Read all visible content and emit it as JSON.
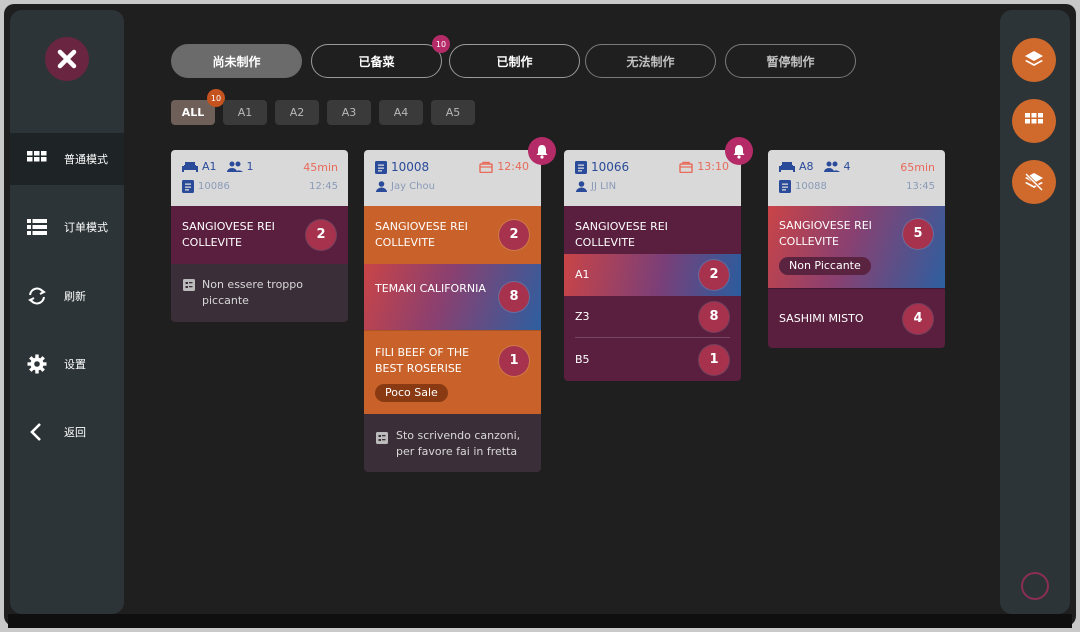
{
  "sidebar": {
    "items": [
      {
        "label": "普通模式",
        "icon": "grid-icon"
      },
      {
        "label": "订单模式",
        "icon": "list-icon"
      },
      {
        "label": "刷新",
        "icon": "refresh-icon"
      },
      {
        "label": "设置",
        "icon": "gear-icon"
      },
      {
        "label": "返回",
        "icon": "chevron-left-icon"
      }
    ]
  },
  "status_tabs": [
    {
      "label": "尚未制作"
    },
    {
      "label": "已备菜",
      "badge": "10"
    },
    {
      "label": "已制作"
    },
    {
      "label": "无法制作"
    },
    {
      "label": "暂停制作"
    }
  ],
  "area_tabs": [
    {
      "label": "ALL",
      "badge": "10"
    },
    {
      "label": "A1"
    },
    {
      "label": "A2"
    },
    {
      "label": "A3"
    },
    {
      "label": "A4"
    },
    {
      "label": "A5"
    }
  ],
  "orders": [
    {
      "table": "A1",
      "guests": "1",
      "time": "45min",
      "order_no": "10086",
      "clock": "12:45",
      "items": [
        {
          "name": "SANGIOVESE REI COLLEVITE",
          "qty": "2"
        }
      ],
      "note": "Non essere troppo piccante"
    },
    {
      "order_no": "10008",
      "time": "12:40",
      "customer": "Jay Chou",
      "items": [
        {
          "name": "SANGIOVESE REI COLLEVITE",
          "qty": "2"
        },
        {
          "name": "TEMAKI CALIFORNIA",
          "qty": "8"
        },
        {
          "name": "FILI BEEF OF THE BEST ROSERISE",
          "qty": "1",
          "tag": "Poco Sale"
        }
      ],
      "note": "Sto scrivendo canzoni, per favore fai in fretta"
    },
    {
      "order_no": "10066",
      "time": "13:10",
      "customer": "JJ LIN",
      "group": "SANGIOVESE REI COLLEVITE",
      "items": [
        {
          "name": "A1",
          "qty": "2"
        },
        {
          "name": "Z3",
          "qty": "8"
        },
        {
          "name": "B5",
          "qty": "1"
        }
      ]
    },
    {
      "table": "A8",
      "guests": "4",
      "time": "65min",
      "order_no": "10088",
      "clock": "13:45",
      "items": [
        {
          "name": "SANGIOVESE REI COLLEVITE",
          "qty": "5",
          "tag": "Non Piccante"
        },
        {
          "name": "SASHIMI MISTO",
          "qty": "4"
        }
      ]
    }
  ],
  "colors": {
    "accent_orange": "#d06a2c",
    "accent_pink": "#b42b67",
    "maroon": "#5a1f3f"
  }
}
